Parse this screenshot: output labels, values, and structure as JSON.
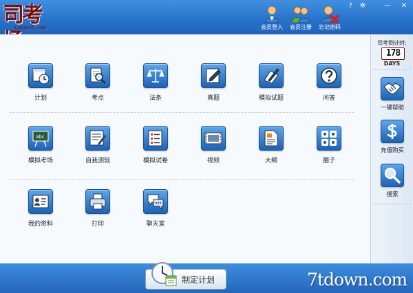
{
  "logo": {
    "main_text": "司考场",
    "sub_text": "sikaoch.com"
  },
  "header_buttons": [
    {
      "label": "会员登入",
      "icon": "member-login-icon"
    },
    {
      "label": "会员注册",
      "icon": "member-register-icon"
    },
    {
      "label": "忘记密码",
      "icon": "forgot-password-icon"
    }
  ],
  "window_controls": {
    "help": "?",
    "settings": "✲",
    "minimize": "—",
    "close": "✕"
  },
  "grid": {
    "row1": [
      "计划",
      "考点",
      "法条",
      "真题",
      "模拟试题",
      "问答"
    ],
    "row2": [
      "模拟考场",
      "自我测验",
      "模拟试卷",
      "视频",
      "大纲",
      "圈子"
    ],
    "row3": [
      "我的资料",
      "打印",
      "聊天室"
    ]
  },
  "sidebar": {
    "countdown_title": "司考倒计时:",
    "countdown_value": "178",
    "countdown_unit": "DAYS",
    "buttons": [
      {
        "label": "一键帮助",
        "icon": "handshake-icon"
      },
      {
        "label": "充值购买",
        "icon": "dollar-icon"
      },
      {
        "label": "搜索",
        "icon": "search-icon"
      }
    ]
  },
  "footer": {
    "plan_button": "制定计划"
  },
  "watermark": "7tdown.com",
  "colors": {
    "header_blue": "#2a74cc",
    "tile_blue": "#1e62b4",
    "logo_red": "#7a1010"
  }
}
